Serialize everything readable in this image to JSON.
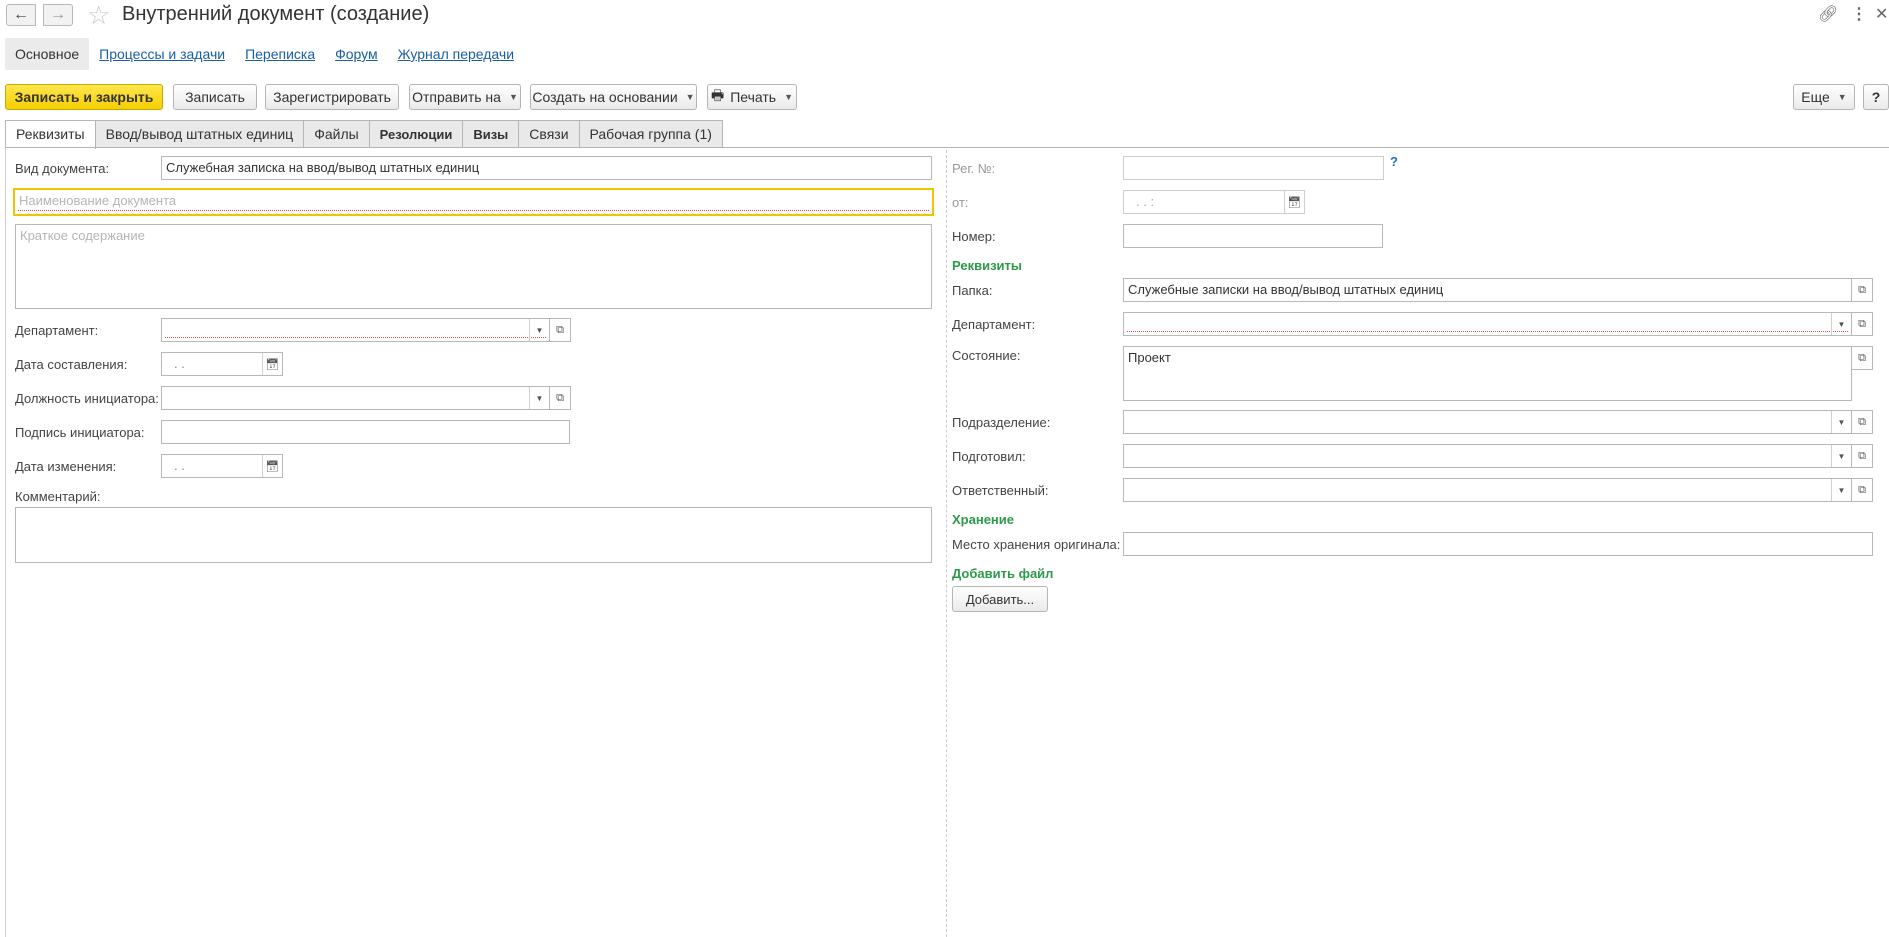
{
  "window": {
    "title": "Внутренний документ (создание)"
  },
  "section_nav": [
    "Основное",
    "Процессы и задачи",
    "Переписка",
    "Форум",
    "Журнал передачи"
  ],
  "toolbar": {
    "save_close": "Записать и закрыть",
    "save": "Записать",
    "register": "Зарегистрировать",
    "send": "Отправить на",
    "create_based": "Создать на основании",
    "print": "Печать",
    "more": "Еще",
    "help": "?"
  },
  "tabs": [
    "Реквизиты",
    "Ввод/вывод штатных единиц",
    "Файлы",
    "Резолюции",
    "Визы",
    "Связи",
    "Рабочая группа (1)"
  ],
  "left": {
    "doc_type_label": "Вид документа:",
    "doc_type_value": "Служебная записка на ввод/вывод штатных единиц",
    "doc_name_placeholder": "Наименование документа",
    "summary_placeholder": "Краткое содержание",
    "department_label": "Департамент:",
    "date_created_label": "Дата составления:",
    "date_placeholder": ".  .",
    "initiator_position_label": "Должность инициатора:",
    "initiator_signature_label": "Подпись инициатора:",
    "date_changed_label": "Дата изменения:",
    "comment_label": "Комментарий:"
  },
  "right": {
    "reg_no_label": "Рег. №:",
    "from_label": "от:",
    "from_placeholder": ".  .       :",
    "number_label": "Номер:",
    "requisites_header": "Реквизиты",
    "folder_label": "Папка:",
    "folder_value": "Служебные записки на ввод/вывод штатных единиц",
    "department_label": "Департамент:",
    "state_label": "Состояние:",
    "state_value": "Проект",
    "subdivision_label": "Подразделение:",
    "prepared_label": "Подготовил:",
    "responsible_label": "Ответственный:",
    "storage_header": "Хранение",
    "storage_label": "Место хранения оригинала:",
    "add_file_header": "Добавить файл",
    "add_button": "Добавить..."
  }
}
